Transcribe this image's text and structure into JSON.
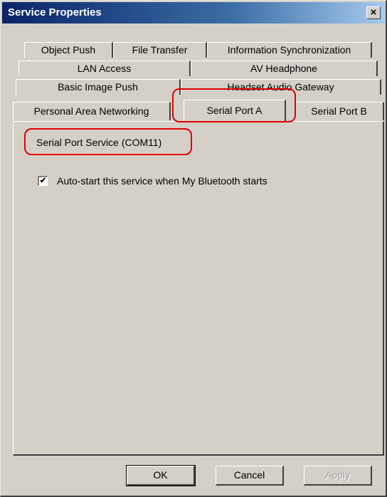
{
  "window": {
    "title": "Service Properties",
    "close_label": "×"
  },
  "tabs": [
    {
      "label": "Object Push"
    },
    {
      "label": "File Transfer"
    },
    {
      "label": "Information Synchronization"
    },
    {
      "label": "LAN Access"
    },
    {
      "label": "AV Headphone"
    },
    {
      "label": "Basic Image Push"
    },
    {
      "label": "Headset Audio Gateway"
    },
    {
      "label": "Personal Area Networking"
    },
    {
      "label": "Serial Port A",
      "active": true
    },
    {
      "label": "Serial Port B"
    }
  ],
  "panel": {
    "service_name": "Serial Port Service (COM11)",
    "autostart": {
      "label": "Auto-start this service when My Bluetooth starts",
      "checked": true,
      "check_glyph": "✔"
    }
  },
  "buttons": {
    "ok": "OK",
    "cancel": "Cancel",
    "apply": "Apply"
  },
  "colors": {
    "highlight": "#e00000",
    "dialog_bg": "#d4d0c8",
    "title_bar": "#0a246a"
  }
}
